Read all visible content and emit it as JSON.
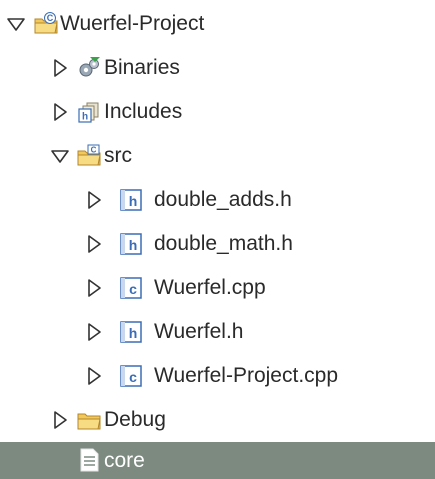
{
  "tree": {
    "project": {
      "label": "Wuerfel-Project",
      "expanded": true,
      "icon": "c-project-folder-icon"
    },
    "binaries": {
      "label": "Binaries",
      "expanded": false,
      "icon": "binaries-icon"
    },
    "includes": {
      "label": "Includes",
      "expanded": false,
      "icon": "includes-icon"
    },
    "src": {
      "label": "src",
      "expanded": true,
      "icon": "source-folder-icon",
      "files": [
        {
          "label": "double_adds.h",
          "icon": "header-file-icon"
        },
        {
          "label": "double_math.h",
          "icon": "header-file-icon"
        },
        {
          "label": "Wuerfel.cpp",
          "icon": "cpp-file-icon"
        },
        {
          "label": "Wuerfel.h",
          "icon": "header-file-icon"
        },
        {
          "label": "Wuerfel-Project.cpp",
          "icon": "cpp-file-icon"
        }
      ]
    },
    "debug": {
      "label": "Debug",
      "expanded": false,
      "icon": "folder-icon"
    },
    "core": {
      "label": "core",
      "selected": true,
      "icon": "text-file-icon"
    }
  },
  "colors": {
    "selection_bg": "#7c8a80",
    "folder_yellow": "#f0c44a",
    "file_blue": "#3a6db5",
    "text": "#2a2a2a"
  }
}
